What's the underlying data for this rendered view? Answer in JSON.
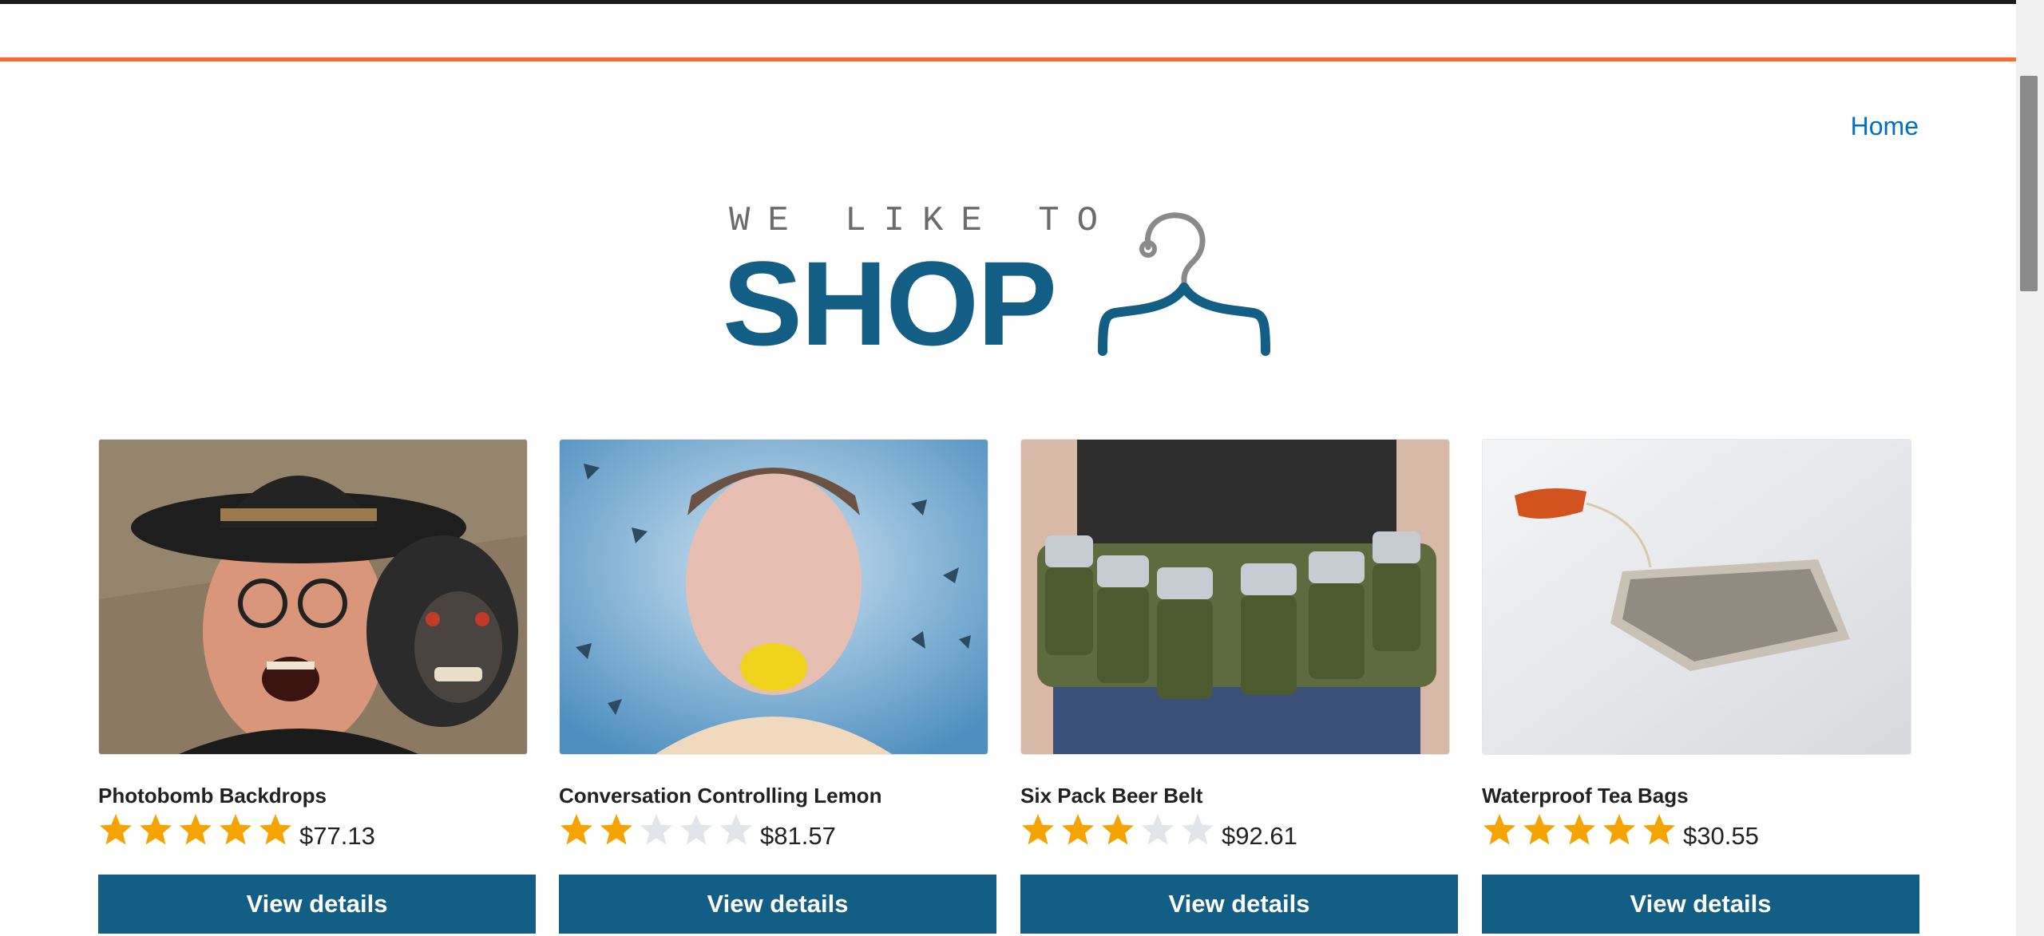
{
  "nav": {
    "home_label": "Home"
  },
  "logo": {
    "tagline": "WE LIKE TO",
    "wordmark": "SHOP"
  },
  "colors": {
    "brand": "#135e85",
    "accent": "#ff6633",
    "link": "#0071c1",
    "star_on": "#f5a300",
    "star_off": "#e2e6ea"
  },
  "products": [
    {
      "name": "Photobomb Backdrops",
      "rating": 5,
      "price": "$77.13",
      "button_label": "View details"
    },
    {
      "name": "Conversation Controlling Lemon",
      "rating": 2,
      "price": "$81.57",
      "button_label": "View details"
    },
    {
      "name": "Six Pack Beer Belt",
      "rating": 3,
      "price": "$92.61",
      "button_label": "View details"
    },
    {
      "name": "Waterproof Tea Bags",
      "rating": 5,
      "price": "$30.55",
      "button_label": "View details"
    }
  ]
}
